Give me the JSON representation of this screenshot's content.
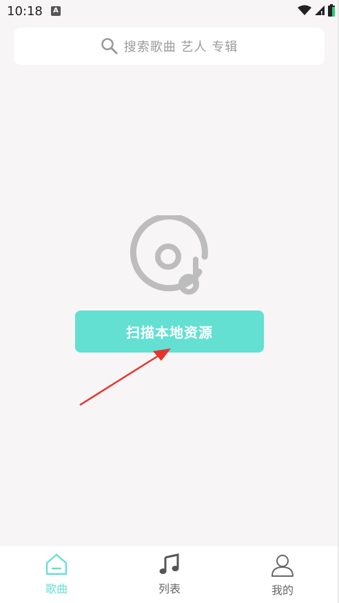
{
  "status_bar": {
    "time": "10:18",
    "notification_letter": "A",
    "icons": [
      "wifi-icon",
      "signal-icon",
      "battery-icon"
    ]
  },
  "search": {
    "placeholder": "搜索歌曲 艺人 专辑",
    "icon": "search-icon"
  },
  "main": {
    "empty_icon": "music-disc-icon",
    "scan_button_label": "扫描本地资源"
  },
  "annotation": {
    "type": "red-arrow",
    "color": "#e8342b"
  },
  "bottom_nav": {
    "items": [
      {
        "label": "歌曲",
        "icon": "home-icon",
        "active": true
      },
      {
        "label": "列表",
        "icon": "music-note-icon",
        "active": false
      },
      {
        "label": "我的",
        "icon": "person-icon",
        "active": false
      }
    ]
  },
  "colors": {
    "accent": "#63e0d2",
    "background": "#f7f5f6",
    "icon_gray": "#bdbdbd"
  }
}
